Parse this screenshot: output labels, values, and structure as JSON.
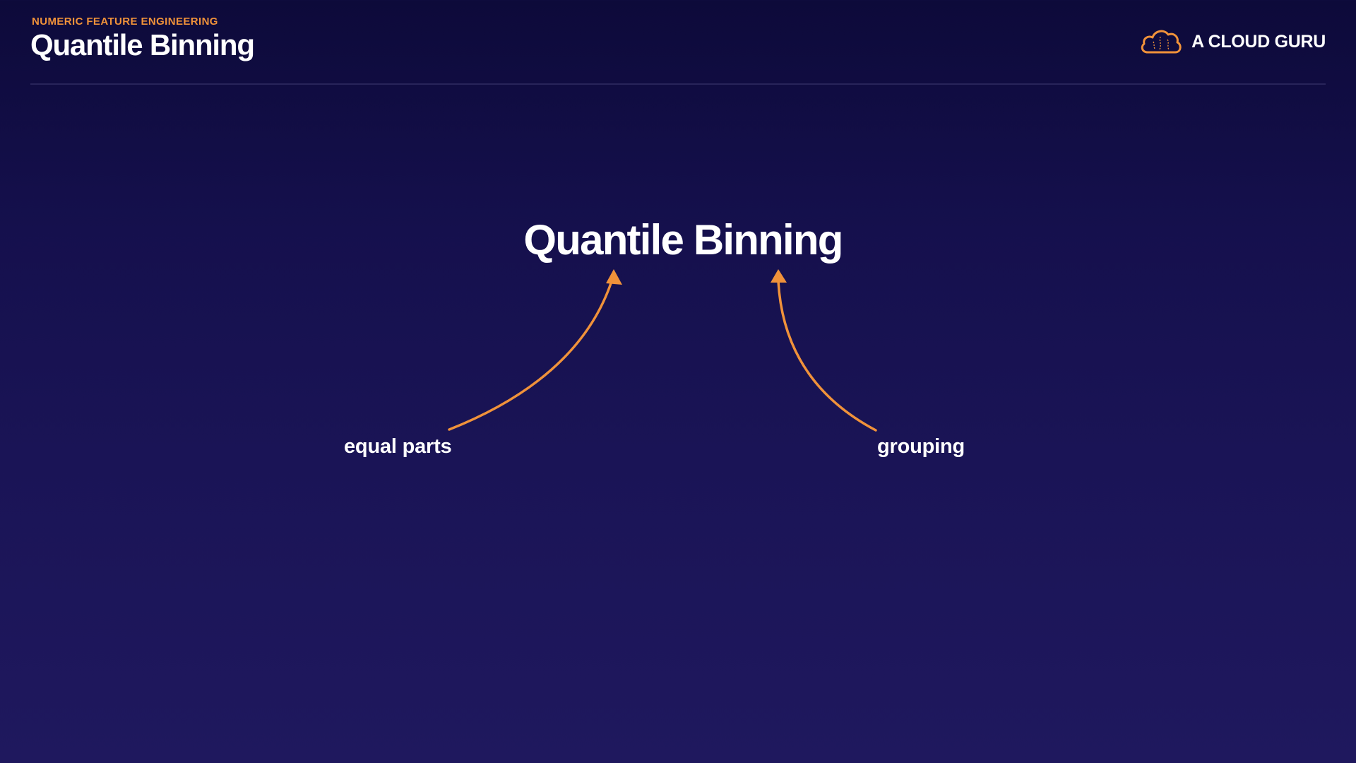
{
  "header": {
    "eyebrow": "NUMERIC FEATURE ENGINEERING",
    "title": "Quantile Binning"
  },
  "logo": {
    "icon": "cloud-icon",
    "text": "A CLOUD GURU",
    "accent_color": "#f0923a"
  },
  "slide": {
    "main_title": "Quantile Binning",
    "labels": {
      "left": "equal parts",
      "right": "grouping"
    },
    "arrow_color": "#f0923a",
    "background_top": "#0d0a3a",
    "background_bottom": "#1f185e"
  }
}
